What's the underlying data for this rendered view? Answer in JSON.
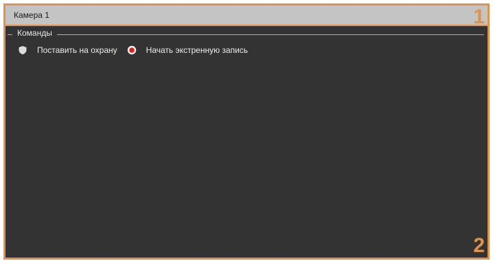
{
  "window": {
    "title": "Камера 1"
  },
  "annotations": {
    "title_bar": "1",
    "commands_panel": "2",
    "color": "#e0944b"
  },
  "commands_group": {
    "legend": "Команды",
    "items": [
      {
        "label": "Поставить на охрану",
        "icon": "shield-icon",
        "color": "#dcdcdc"
      },
      {
        "label": "Начать экстренную запись",
        "icon": "record-icon",
        "color": "#e21c1c"
      }
    ]
  }
}
